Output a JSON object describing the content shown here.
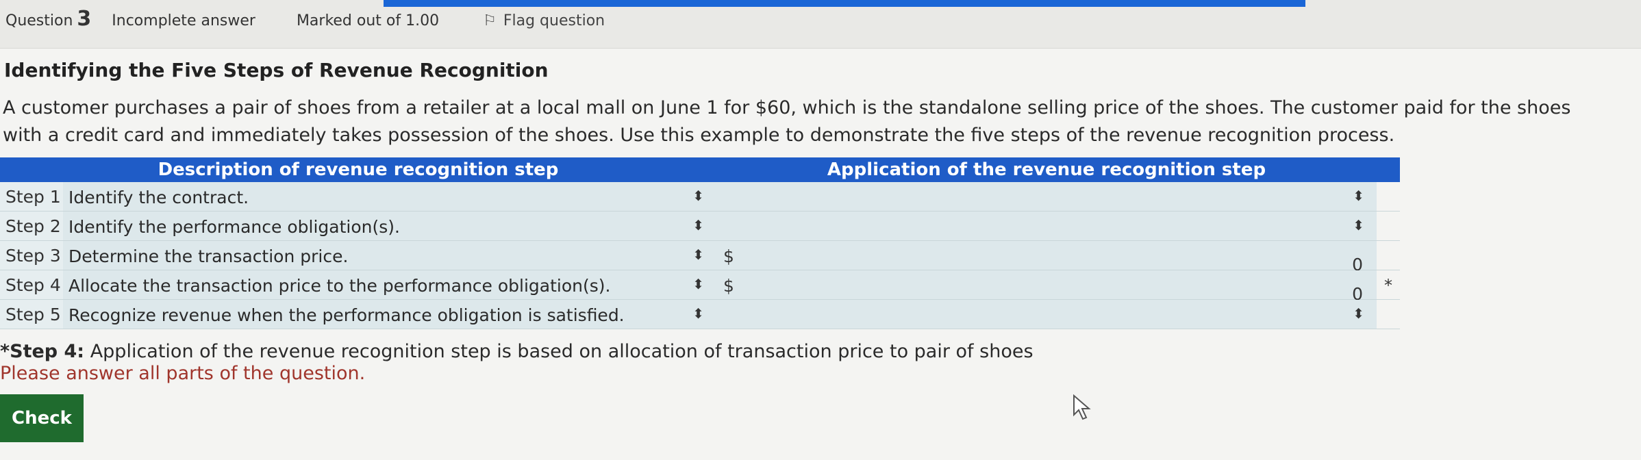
{
  "header": {
    "question_label": "Question",
    "question_number": "3",
    "status": "Incomplete answer",
    "marks": "Marked out of 1.00",
    "flag_label": "Flag question"
  },
  "problem": {
    "title": "Identifying the Five Steps of Revenue Recognition",
    "description": "A customer purchases a pair of shoes from a retailer at a local mall on June 1 for $60, which is the standalone selling price of the shoes. The customer paid for the shoes with a credit card and immediately takes possession of the shoes. Use this example to demonstrate the five steps of the revenue recognition process."
  },
  "table": {
    "col_description": "Description of revenue recognition step",
    "col_application": "Application of the revenue recognition step",
    "rows": [
      {
        "step": "Step 1",
        "description": "Identify the contract.",
        "dollar": "",
        "amount": "",
        "mark": ""
      },
      {
        "step": "Step 2",
        "description": "Identify the performance obligation(s).",
        "dollar": "",
        "amount": "",
        "mark": ""
      },
      {
        "step": "Step 3",
        "description": "Determine the transaction price.",
        "dollar": "$",
        "amount": "0",
        "mark": ""
      },
      {
        "step": "Step 4",
        "description": "Allocate the transaction price to the performance obligation(s).",
        "dollar": "$",
        "amount": "0",
        "mark": "*"
      },
      {
        "step": "Step 5",
        "description": "Recognize revenue when the performance obligation is satisfied.",
        "dollar": "",
        "amount": "",
        "mark": ""
      }
    ]
  },
  "note": {
    "label": "*Step 4:",
    "text": " Application of the revenue recognition step is based on allocation of transaction price to pair of shoes"
  },
  "warning": "Please answer all parts of the question.",
  "check_label": "Check",
  "icons": {
    "flag": "flag-icon",
    "select_arrow": "updown-arrow-icon",
    "cursor": "mouse-cursor-icon"
  },
  "colors": {
    "header_blue": "#1f5cc7",
    "check_green": "#1f6b2e",
    "warning_red": "#a0352c"
  }
}
